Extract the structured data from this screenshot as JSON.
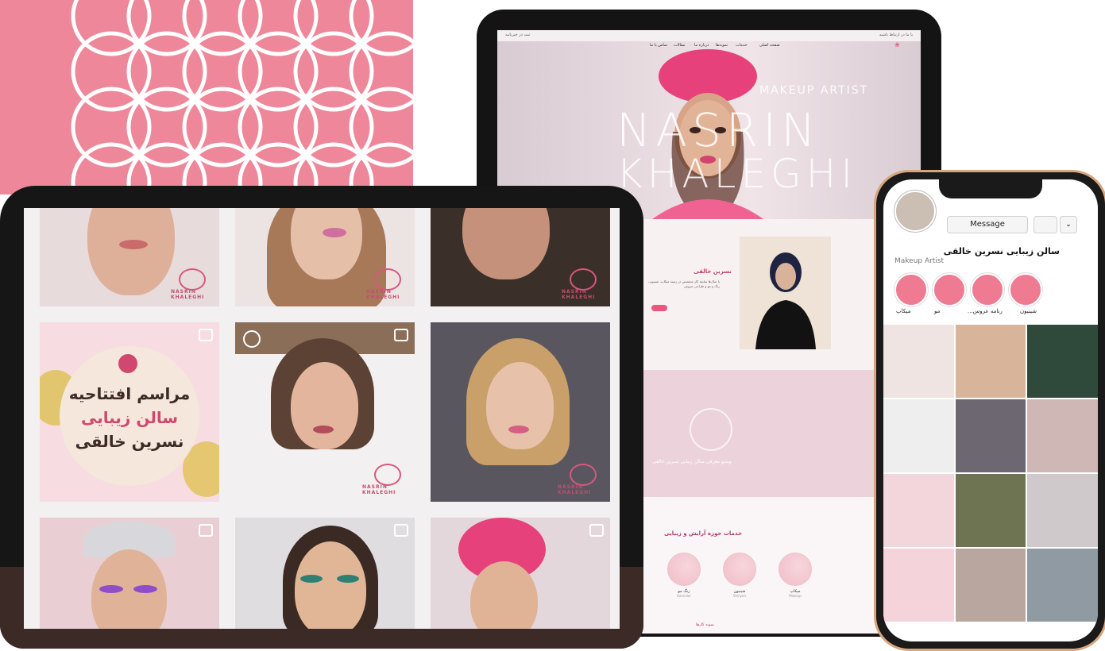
{
  "tablet": {
    "topbar_left": "ثبت در خبرنامه",
    "topbar_right": "با ما در ارتباط باشید",
    "nav": [
      "صفحه اصلی",
      "خدمات",
      "نمونه‌ها",
      "درباره ما",
      "مقالات",
      "تماس با ما"
    ],
    "hero_line1": "NASRIN",
    "hero_line2": "KHALEGHI",
    "hero_tag": "MAKEUP ARTIST",
    "about_title": "نسرین خالقی",
    "about_body": "با سال‌ها سابقه کار متخصص در زمینه میکاپ، شینیون، رنگ و مو و طراحی عروس",
    "video_caption": "ویدیو معرفی سالن زیبایی نسرین خالقی",
    "services_title": "خدمات حوزه آرایش و زیبایی",
    "services": [
      {
        "label": "میکاپ",
        "sub": "Makeup"
      },
      {
        "label": "شینیون",
        "sub": "Shinyon"
      },
      {
        "label": "رنگ مو",
        "sub": "Haircolor"
      }
    ],
    "footer_hint": "نمونه کارها"
  },
  "ipad": {
    "brand": "NASRIN KHALEGHI",
    "promo_line1": "مراسم افتتاحیه",
    "promo_line2": "سالن زیبایی",
    "promo_line3": "نسرین خالقی"
  },
  "phone": {
    "message_button": "Message",
    "more_button": "⌄",
    "profile_name": "سالن زیبایی نسرین خالقی",
    "profile_category": "Makeup Artist",
    "highlights": [
      "شینیون",
      "عروس",
      "مو",
      "میکاپ"
    ],
    "highlight_label_1": "شینیون",
    "highlight_label_2": "...رنامه عروس",
    "highlight_label_3": "مو",
    "highlight_label_4": "میکاپ"
  },
  "colors": {
    "accent_pink": "#ee8799",
    "device_dark": "#161616",
    "phone_frame": "#d8a67c"
  }
}
